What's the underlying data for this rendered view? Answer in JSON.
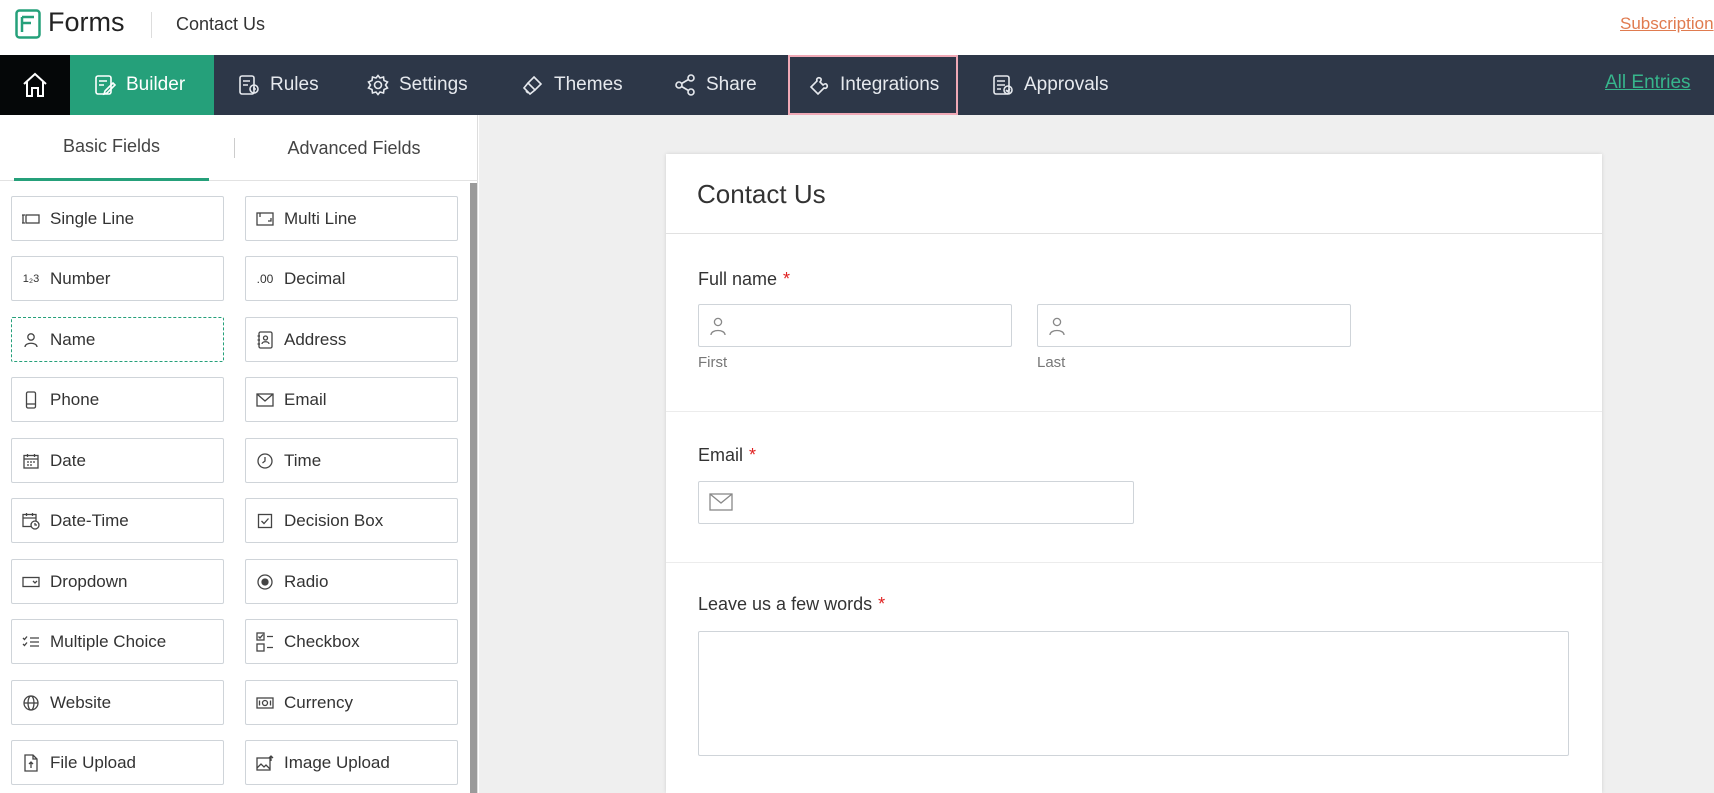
{
  "app": {
    "name": "Forms",
    "form_title": "Contact Us",
    "subscription_link": "Subscription"
  },
  "nav": {
    "items": [
      {
        "label": "Builder",
        "icon": "builder-icon"
      },
      {
        "label": "Rules",
        "icon": "rules-icon"
      },
      {
        "label": "Settings",
        "icon": "gear-icon"
      },
      {
        "label": "Themes",
        "icon": "brush-icon"
      },
      {
        "label": "Share",
        "icon": "share-icon"
      },
      {
        "label": "Integrations",
        "icon": "puzzle-icon"
      },
      {
        "label": "Approvals",
        "icon": "approvals-icon"
      }
    ],
    "all_entries": "All Entries"
  },
  "tabs": {
    "basic": "Basic Fields",
    "advanced": "Advanced Fields"
  },
  "fields": [
    [
      "Single Line",
      "Multi Line"
    ],
    [
      "Number",
      "Decimal"
    ],
    [
      "Name",
      "Address"
    ],
    [
      "Phone",
      "Email"
    ],
    [
      "Date",
      "Time"
    ],
    [
      "Date-Time",
      "Decision Box"
    ],
    [
      "Dropdown",
      "Radio"
    ],
    [
      "Multiple Choice",
      "Checkbox"
    ],
    [
      "Website",
      "Currency"
    ],
    [
      "File Upload",
      "Image Upload"
    ]
  ],
  "form": {
    "heading": "Contact Us",
    "full_name": {
      "label": "Full name",
      "required": "*",
      "first": "First",
      "last": "Last"
    },
    "email": {
      "label": "Email",
      "required": "*"
    },
    "words": {
      "label": "Leave us a few words",
      "required": "*"
    }
  },
  "colors": {
    "nav_bg": "#2d3748",
    "accent": "#25a07a",
    "link": "#37b58c",
    "subscription": "#e07b4f",
    "required": "#e02020"
  }
}
